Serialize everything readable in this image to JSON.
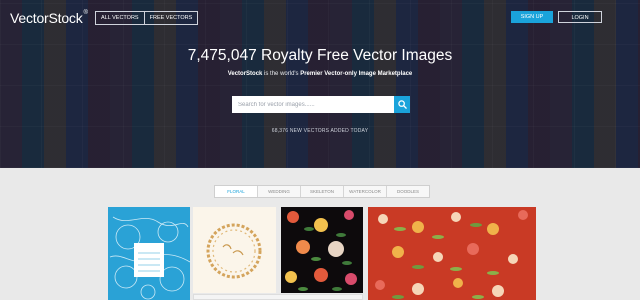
{
  "header": {
    "logo": "VectorStock",
    "logo_mark": "®",
    "nav": [
      "ALL VECTORS",
      "FREE VECTORS"
    ],
    "signup_label": "SIGN UP",
    "login_label": "LOGIN"
  },
  "hero": {
    "headline": "7,475,047 Royalty Free Vector Images",
    "tagline_brand": "VectorStock",
    "tagline_middle": " is the world's ",
    "tagline_bold": "Premier Vector-only Image Marketplace",
    "search_placeholder": "Search for vector images......",
    "added_text": "68,376 NEW VECTORS ADDED TODAY"
  },
  "tabs": [
    "FLORAL",
    "WEDDING",
    "SKELETON",
    "WATERCOLOR",
    "DOODLES"
  ],
  "active_tab": "FLORAL",
  "colors": {
    "accent": "#1aa3db",
    "hero_overlay": "#141c30",
    "background": "#e9e9e9"
  },
  "gallery": [
    {
      "name": "blue-floral-doodle-card"
    },
    {
      "name": "thank-you-wreath-card"
    },
    {
      "name": "dark-floral-pattern"
    },
    {
      "name": "red-floral-pattern"
    }
  ]
}
